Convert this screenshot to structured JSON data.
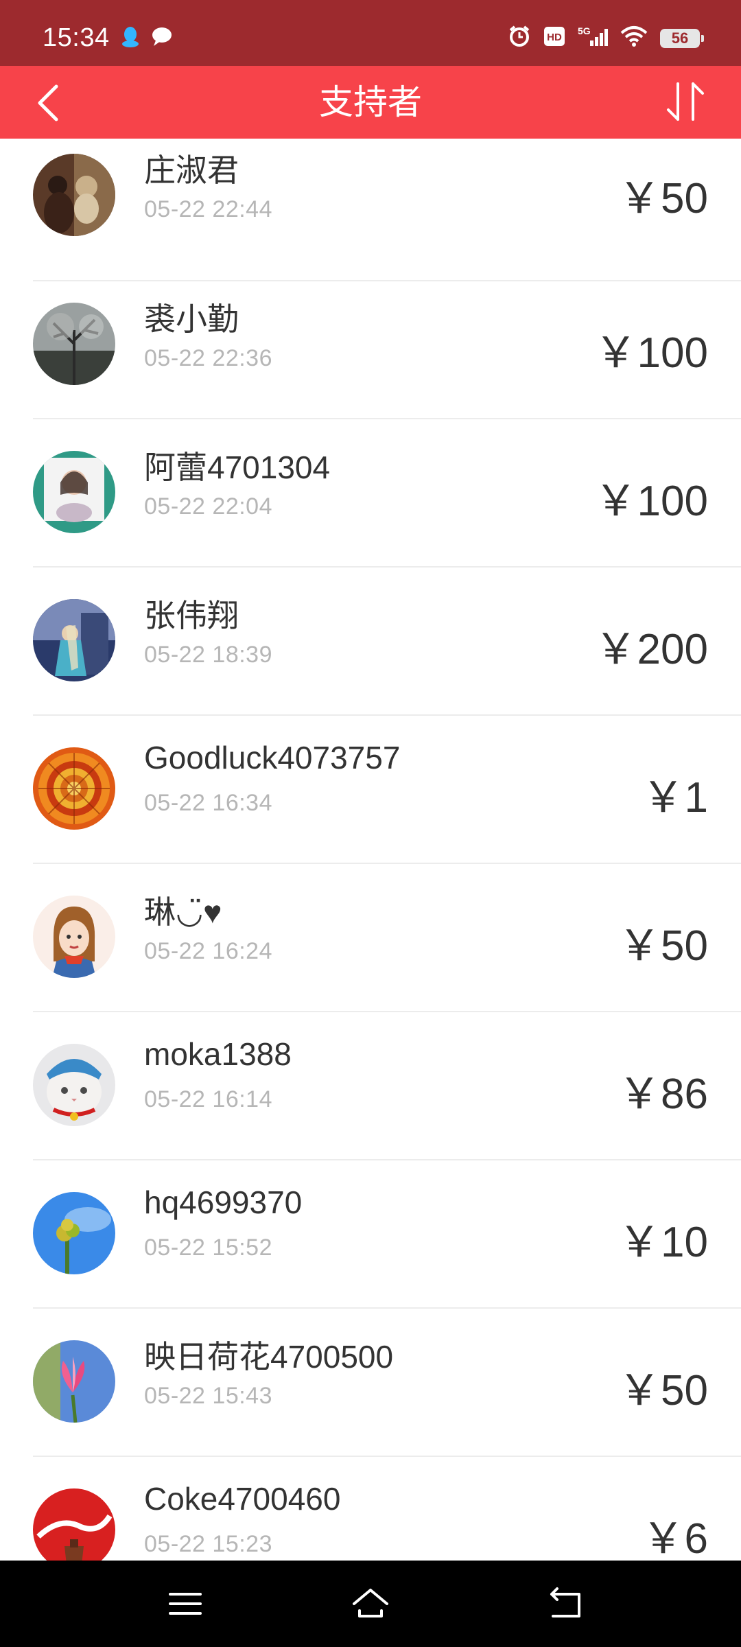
{
  "status_bar": {
    "time": "15:34",
    "battery": "56",
    "left_icons": [
      "qq-penguin-icon",
      "chat-bubble-icon"
    ],
    "right_icons": [
      "alarm-icon",
      "hd-icon",
      "5g-signal-icon",
      "wifi-icon",
      "battery-icon"
    ]
  },
  "nav": {
    "title": "支持者",
    "back_icon": "chevron-left-icon",
    "sort_icon": "sort-arrows-icon"
  },
  "colors": {
    "status_bar": "#9d2a2e",
    "nav_bar": "#f7434a",
    "name_text": "#333333",
    "time_text": "#b6b6b6",
    "divider": "#ececec"
  },
  "supporters": [
    {
      "name": "庄淑君",
      "time": "05-22 22:44",
      "amount": "￥50"
    },
    {
      "name": "裘小勤",
      "time": "05-22 22:36",
      "amount": "￥100"
    },
    {
      "name": "阿蕾4701304",
      "time": "05-22 22:04",
      "amount": "￥100"
    },
    {
      "name": "张伟翔",
      "time": "05-22 18:39",
      "amount": "￥200"
    },
    {
      "name": "Goodluck4073757",
      "time": "05-22 16:34",
      "amount": "￥1"
    },
    {
      "name": "琳◡̈♥",
      "time": "05-22 16:24",
      "amount": "￥50"
    },
    {
      "name": "moka1388",
      "time": "05-22 16:14",
      "amount": "￥86"
    },
    {
      "name": "hq4699370",
      "time": "05-22 15:52",
      "amount": "￥10"
    },
    {
      "name": "映日荷花4700500",
      "time": "05-22 15:43",
      "amount": "￥50"
    },
    {
      "name": "Coke4700460",
      "time": "05-22 15:23",
      "amount": "￥6"
    }
  ],
  "system_nav": {
    "menu_icon": "menu-lines-icon",
    "home_icon": "home-icon",
    "back_icon": "back-return-icon"
  }
}
